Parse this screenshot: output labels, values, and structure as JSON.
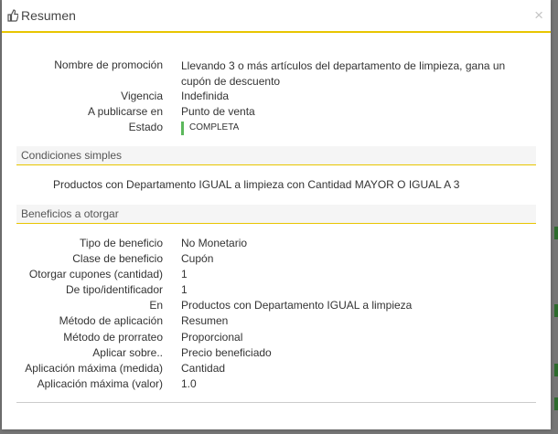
{
  "modal": {
    "title": "Resumen",
    "close_symbol": "×",
    "header_icon": "thumbs-up-icon"
  },
  "summary": {
    "promo_label": "Nombre de promoción",
    "promo_value": "Llevando 3 o más artículos del departamento de limpieza, gana un cupón de descuento",
    "validity_label": "Vigencia",
    "validity_value": "Indefinida",
    "publish_label": "A publicarse en",
    "publish_value": "Punto de venta",
    "status_label": "Estado",
    "status_value": "COMPLETA"
  },
  "conditions": {
    "title": "Condiciones simples",
    "text": "Productos con Departamento IGUAL a limpieza con Cantidad MAYOR O IGUAL A 3"
  },
  "benefits": {
    "title": "Beneficios a otorgar",
    "rows": [
      {
        "label": "Tipo de beneficio",
        "value": "No Monetario"
      },
      {
        "label": "Clase de beneficio",
        "value": "Cupón"
      },
      {
        "label": "Otorgar cupones (cantidad)",
        "value": "1"
      },
      {
        "label": "De tipo/identificador",
        "value": "1"
      },
      {
        "label": "En",
        "value": "Productos con Departamento IGUAL a limpieza"
      },
      {
        "label": "Método de aplicación",
        "value": "Resumen"
      },
      {
        "label": "Método de prorrateo",
        "value": "Proporcional"
      },
      {
        "label": "Aplicar sobre..",
        "value": "Precio beneficiado"
      },
      {
        "label": "Aplicación máxima (medida)",
        "value": "Cantidad"
      },
      {
        "label": "Aplicación máxima (valor)",
        "value": "1.0"
      }
    ]
  },
  "colors": {
    "accent": "#e8c500",
    "status_ok": "#5cb85c"
  }
}
